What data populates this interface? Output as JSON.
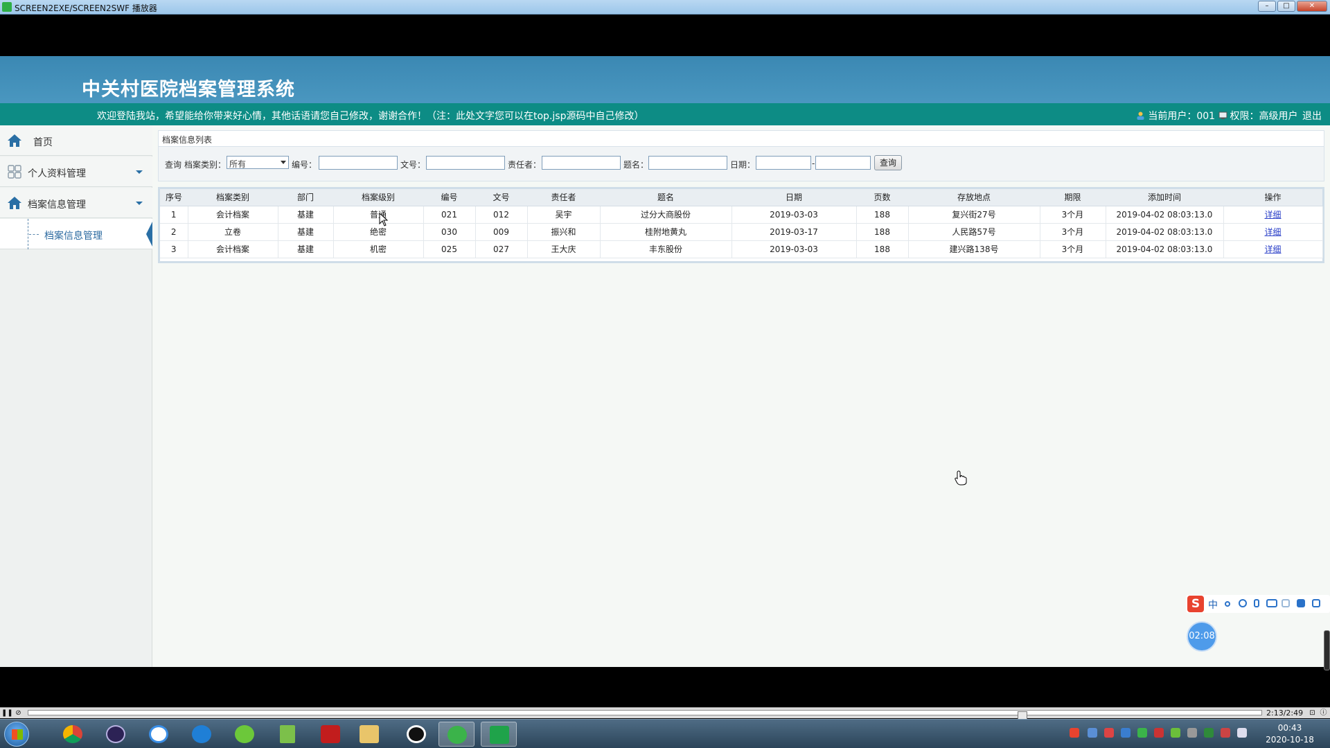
{
  "window": {
    "title": "SCREEN2EXE/SCREEN2SWF 播放器"
  },
  "header": {
    "system_title": "中关村医院档案管理系统",
    "welcome_text": "欢迎登陆我站，希望能给你带来好心情，其他话语请您自己修改，谢谢合作！（注：此处文字您可以在top.jsp源码中自己修改）",
    "current_user_label": "当前用户：001",
    "permission_label": "权限：高级用户",
    "logout_label": "退出"
  },
  "sidebar": {
    "items": [
      {
        "label": "首页",
        "icon": "home-icon"
      },
      {
        "label": "个人资料管理",
        "icon": "grid-icon"
      },
      {
        "label": "档案信息管理",
        "icon": "home-icon"
      }
    ],
    "sub_items": [
      {
        "label": "档案信息管理"
      }
    ]
  },
  "panel": {
    "title": "档案信息列表"
  },
  "search": {
    "query_label": "查询",
    "category_label": "档案类别：",
    "category_value": "所有",
    "number_label": "编号：",
    "doc_no_label": "文号：",
    "owner_label": "责任者：",
    "title_label": "题名：",
    "date_label": "日期：",
    "date_separator": "-",
    "button_label": "查询"
  },
  "table": {
    "columns": [
      "序号",
      "档案类别",
      "部门",
      "档案级别",
      "编号",
      "文号",
      "责任者",
      "题名",
      "日期",
      "页数",
      "存放地点",
      "期限",
      "添加时间",
      "操作"
    ],
    "rows": [
      [
        "1",
        "会计档案",
        "基建",
        "普通",
        "021",
        "012",
        "吴宇",
        "过分大商股份",
        "2019-03-03",
        "188",
        "复兴街27号",
        "3个月",
        "2019-04-02 08:03:13.0",
        "详细"
      ],
      [
        "2",
        "立卷",
        "基建",
        "绝密",
        "030",
        "009",
        "振兴和",
        "桂附地黄丸",
        "2019-03-17",
        "188",
        "人民路57号",
        "3个月",
        "2019-04-02 08:03:13.0",
        "详细"
      ],
      [
        "3",
        "会计档案",
        "基建",
        "机密",
        "025",
        "027",
        "王大庆",
        "丰东股份",
        "2019-03-03",
        "188",
        "建兴路138号",
        "3个月",
        "2019-04-02 08:03:13.0",
        "详细"
      ]
    ]
  },
  "overlay": {
    "ime_label": "中",
    "timer": "02:08"
  },
  "player": {
    "time": "2:13/2:49"
  },
  "taskbar": {
    "clock_time": "00:43",
    "clock_date": "2020-10-18"
  },
  "colors": {
    "header_blue": "#3b88b3",
    "welcome_teal": "#0d8c85",
    "sidebar_accent": "#2a6fa5",
    "link_blue": "#2a3fc8"
  }
}
